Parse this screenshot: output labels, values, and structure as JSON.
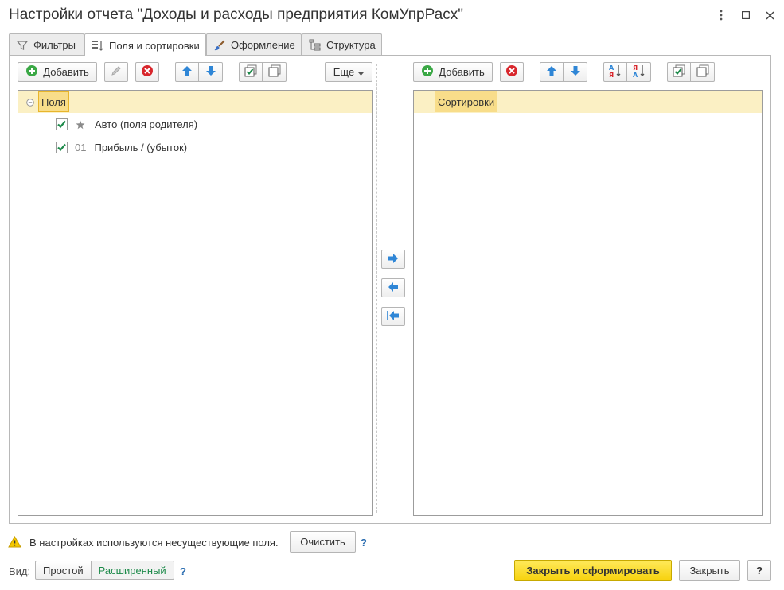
{
  "window": {
    "title": "Настройки отчета \"Доходы и расходы предприятия КомУпрРасх\""
  },
  "tabs": [
    {
      "label": "Фильтры",
      "icon": "filter-icon"
    },
    {
      "label": "Поля и сортировки",
      "icon": "fields-sort-icon"
    },
    {
      "label": "Оформление",
      "icon": "brush-icon"
    },
    {
      "label": "Структура",
      "icon": "structure-icon"
    }
  ],
  "fields_pane": {
    "add_label": "Добавить",
    "more_label": "Еще",
    "header": "Поля",
    "rows": [
      {
        "prefix": "",
        "label": "Авто (поля родителя)",
        "checked": true,
        "icon": "star-icon"
      },
      {
        "prefix": "01",
        "label": "Прибыль / (убыток)",
        "checked": true
      }
    ]
  },
  "sort_pane": {
    "add_label": "Добавить",
    "header": "Сортировки"
  },
  "bottom": {
    "warning_text": "В настройках используются несуществующие поля.",
    "clear_label": "Очистить",
    "help": "?",
    "view_label": "Вид:",
    "mode_simple": "Простой",
    "mode_extended": "Расширенный",
    "primary_label": "Закрыть и сформировать",
    "close_label": "Закрыть"
  },
  "colors": {
    "accent_yellow": "#f7d20d",
    "selection": "#fbf0c4",
    "header_cell": "#f8dd8a",
    "check_green": "#1d8a4a",
    "arrow_blue": "#2f86d6",
    "delete_red": "#d8262c"
  }
}
